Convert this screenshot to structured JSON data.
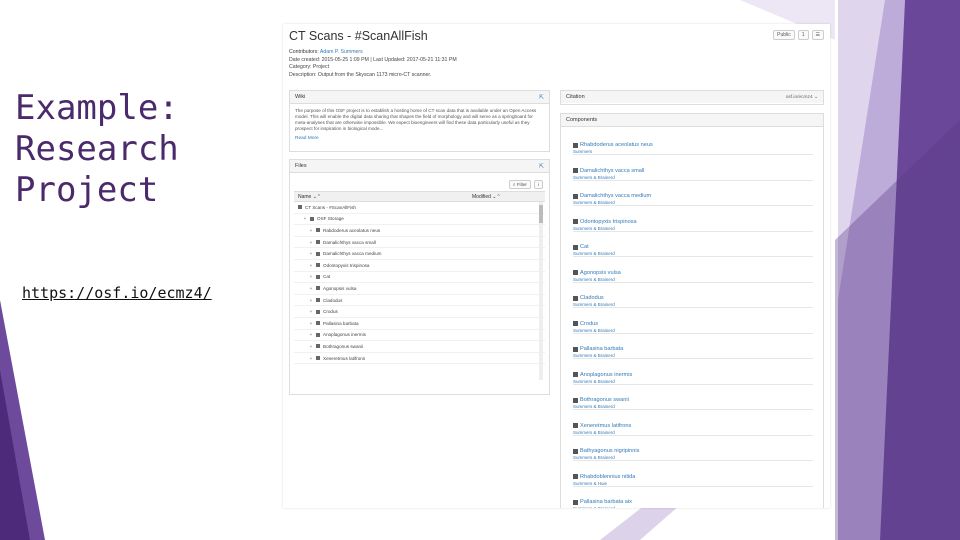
{
  "slide": {
    "title_lines": [
      "Example:",
      "Research",
      "Project"
    ],
    "link": "https://osf.io/ecmz4/",
    "colors": {
      "purple_dark": "#4e2a7a",
      "purple_mid": "#6e4a9c",
      "purple_light": "#9a7ec4",
      "title_text": "#4b2a6b"
    }
  },
  "screenshot": {
    "project_title": "CT Scans - #ScanAllFish",
    "top_buttons": [
      "Public",
      "1"
    ],
    "meta": {
      "contributors_label": "Contributors:",
      "contributors_value": "Adam P. Summers",
      "date_line": "Date created: 2015-05-25 1:09 PM | Last Updated: 2017-05-21 11:31 PM",
      "category": "Category: Project",
      "description": "Description: Output from the Skyscan 1173 micro-CT scanner."
    },
    "wiki": {
      "header": "Wiki",
      "body": "The purpose of this OSF project is to establish a hosting home of CT scan data that is available under an Open Access model. This will enable the digital data sharing that shapes the field of morphology and will serve as a springboard for meta-analyses that are otherwise impossible. We expect bioengineers will find these data particularly useful as they prospect for inspiration in biological mode...",
      "read_more": "Read More"
    },
    "files": {
      "header": "Files",
      "filter_label": "Filter",
      "columns": [
        "Name",
        "Modified"
      ],
      "rows": [
        "CT Scans - #ScanAllFish",
        "OSF Storage",
        "Rabdoderus aceolatus neus",
        "Damalichthys vacca small",
        "Damalichthys vacca medium",
        "Odontopyxis trispinosa",
        "Cat",
        "Agonopsis vulsa",
        "Cladodus",
        "Crodus",
        "Pallasina barbata",
        "Anoplagonus inermis",
        "Bothragonus swanii",
        "Xeneretmus latifrons"
      ]
    },
    "citation": {
      "header": "Citation",
      "right": "osf.io/ecmz4"
    },
    "components": {
      "header": "Components",
      "items": [
        {
          "name": "Rhabdoderus aceolatus neus",
          "sub": "Summers"
        },
        {
          "name": "Damalichthys vacca small",
          "sub": "Summers & Brainerd"
        },
        {
          "name": "Damalichthys vacca medium",
          "sub": "Summers & Brainerd"
        },
        {
          "name": "Odontopyxis trispinosa",
          "sub": "Summers & Brainerd"
        },
        {
          "name": "Cat",
          "sub": "Summers & Brainerd"
        },
        {
          "name": "Agonopsis vulsa",
          "sub": "Summers & Brainerd"
        },
        {
          "name": "Cladodus",
          "sub": "Summers & Brainerd"
        },
        {
          "name": "Crodus",
          "sub": "Summers & Brainerd"
        },
        {
          "name": "Pallasina barbata",
          "sub": "Summers & Brainerd"
        },
        {
          "name": "Anoplagonus inermis",
          "sub": "Summers & Brainerd"
        },
        {
          "name": "Bothragonus swanii",
          "sub": "Summers & Brainerd"
        },
        {
          "name": "Xeneretmus latifrons",
          "sub": "Summers & Brainerd"
        },
        {
          "name": "Bathyagonus nigripinnis",
          "sub": "Summers & Brainerd"
        },
        {
          "name": "Rhabdoblennius nitida",
          "sub": "Summers & Huie"
        },
        {
          "name": "Pallasina barbata aix",
          "sub": "Summers & Brainerd"
        }
      ]
    }
  }
}
